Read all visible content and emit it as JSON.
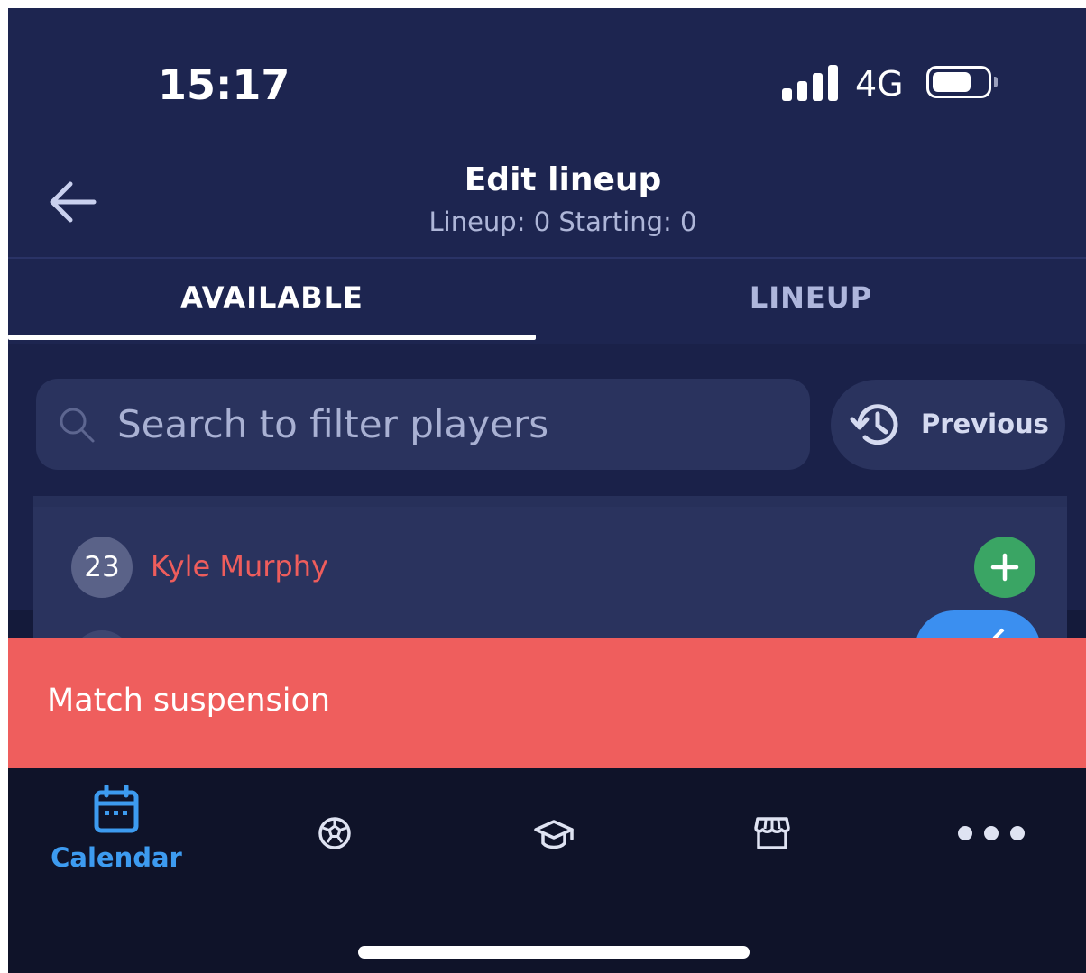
{
  "status_bar": {
    "time": "15:17",
    "network": "4G",
    "battery_level": 0.72
  },
  "header": {
    "title": "Edit lineup",
    "subtitle": "Lineup: 0 Starting: 0"
  },
  "tabs": [
    {
      "label": "AVAILABLE",
      "active": true
    },
    {
      "label": "LINEUP",
      "active": false
    }
  ],
  "search": {
    "placeholder": "Search to filter players",
    "value": ""
  },
  "previous_button": {
    "label": "Previous"
  },
  "players": [
    {
      "number": "23",
      "name": "Kyle Murphy"
    }
  ],
  "banner": {
    "text": "Match suspension",
    "color": "#ef5e5d"
  },
  "bottom_nav": [
    {
      "icon": "calendar-icon",
      "label": "Calendar",
      "active": true
    },
    {
      "icon": "soccer-ball-icon",
      "label": "",
      "active": false
    },
    {
      "icon": "graduation-cap-icon",
      "label": "",
      "active": false
    },
    {
      "icon": "store-icon",
      "label": "",
      "active": false
    },
    {
      "icon": "more-icon",
      "label": "",
      "active": false
    }
  ],
  "colors": {
    "background": "#1d2550",
    "accent": "#3d9bf0",
    "add_button": "#3aa564",
    "player_name": "#ee5d5c"
  }
}
